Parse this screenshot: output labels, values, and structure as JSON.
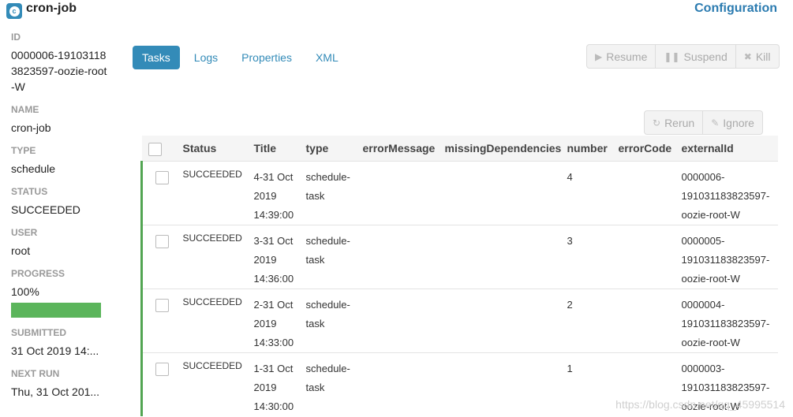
{
  "header": {
    "logo_letter": "c",
    "title": "cron-job",
    "config_link": "Configuration"
  },
  "sidebar": {
    "id_label": "ID",
    "id_value": "0000006-191031183823597-oozie-root-W",
    "name_label": "NAME",
    "name_value": "cron-job",
    "type_label": "TYPE",
    "type_value": "schedule",
    "status_label": "STATUS",
    "status_value": "SUCCEEDED",
    "user_label": "USER",
    "user_value": "root",
    "progress_label": "PROGRESS",
    "progress_value": "100%",
    "progress_fraction": 1.0,
    "submitted_label": "SUBMITTED",
    "submitted_value": "31 Oct 2019 14:...",
    "next_run_label": "NEXT RUN",
    "next_run_value": "Thu, 31 Oct 201..."
  },
  "tabs": [
    {
      "label": "Tasks",
      "active": true
    },
    {
      "label": "Logs",
      "active": false
    },
    {
      "label": "Properties",
      "active": false
    },
    {
      "label": "XML",
      "active": false
    }
  ],
  "actions": {
    "resume": "Resume",
    "suspend": "Suspend",
    "kill": "Kill",
    "rerun": "Rerun",
    "ignore": "Ignore"
  },
  "table": {
    "columns": [
      "Status",
      "Title",
      "type",
      "errorMessage",
      "missingDependencies",
      "number",
      "errorCode",
      "externalId"
    ],
    "rows": [
      {
        "status": "SUCCEEDED",
        "title": "4-31 Oct 2019 14:39:00",
        "type": "schedule-task",
        "errorMessage": "",
        "missingDependencies": "",
        "number": "4",
        "errorCode": "",
        "externalId": "0000006-191031183823597-oozie-root-W"
      },
      {
        "status": "SUCCEEDED",
        "title": "3-31 Oct 2019 14:36:00",
        "type": "schedule-task",
        "errorMessage": "",
        "missingDependencies": "",
        "number": "3",
        "errorCode": "",
        "externalId": "0000005-191031183823597-oozie-root-W"
      },
      {
        "status": "SUCCEEDED",
        "title": "2-31 Oct 2019 14:33:00",
        "type": "schedule-task",
        "errorMessage": "",
        "missingDependencies": "",
        "number": "2",
        "errorCode": "",
        "externalId": "0000004-191031183823597-oozie-root-W"
      },
      {
        "status": "SUCCEEDED",
        "title": "1-31 Oct 2019 14:30:00",
        "type": "schedule-task",
        "errorMessage": "",
        "missingDependencies": "",
        "number": "1",
        "errorCode": "",
        "externalId": "0000003-191031183823597-oozie-root-W"
      }
    ]
  },
  "watermark": "https://blog.csdn.net/qq_45995514",
  "colors": {
    "accent": "#338bb8",
    "success": "#5bb55b",
    "row_marker": "#52a552"
  }
}
